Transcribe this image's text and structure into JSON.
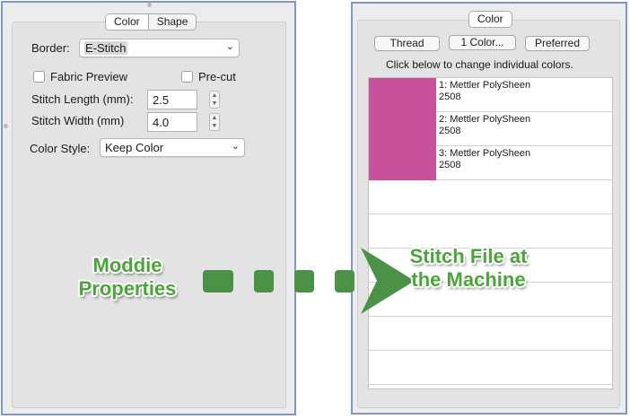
{
  "left_panel": {
    "tabs": [
      {
        "label": "Color",
        "selected": true
      },
      {
        "label": "Shape",
        "selected": false
      }
    ],
    "border": {
      "label": "Border:",
      "value": "E-Stitch"
    },
    "fabric_preview": {
      "label": "Fabric Preview",
      "checked": false
    },
    "pre_cut": {
      "label": "Pre-cut",
      "checked": false
    },
    "stitch_length": {
      "label": "Stitch Length (mm):",
      "value": "2.5"
    },
    "stitch_width": {
      "label": "Stitch Width (mm)",
      "value": "4.0"
    },
    "color_style": {
      "label": "Color Style:",
      "value": "Keep Color"
    }
  },
  "right_panel": {
    "tab": "Color",
    "buttons": {
      "thread": "Thread",
      "one_color": "1 Color...",
      "preferred": "Preferred"
    },
    "hint": "Click below to change individual colors.",
    "threads": [
      {
        "name": "1: Mettler PolySheen",
        "code": "2508",
        "color": "#c8529a"
      },
      {
        "name": "2: Mettler PolySheen",
        "code": "2508",
        "color": "#c8529a"
      },
      {
        "name": "3: Mettler PolySheen",
        "code": "2508",
        "color": "#c8529a"
      }
    ],
    "empty_rows": 6
  },
  "overlay": {
    "left_caption": "Moddie Properties",
    "right_caption": "Stitch File at the Machine",
    "arrow_color": "#4b9146",
    "caption_color": "#4aa53a"
  },
  "icons": {
    "select_chevron": "chevron-down-icon",
    "stepper": "stepper-arrows-icon"
  }
}
